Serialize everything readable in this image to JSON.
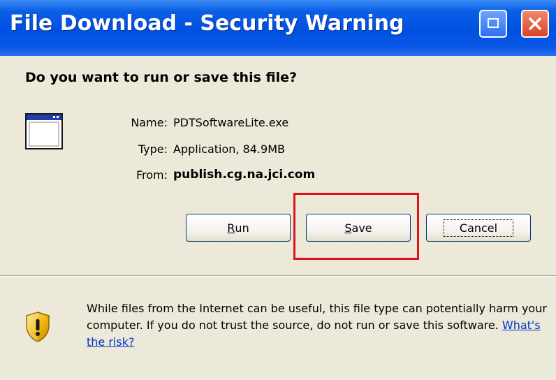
{
  "window": {
    "title": "File Download - Security Warning"
  },
  "dialog": {
    "question": "Do you want to run or save this file?",
    "file": {
      "name_label": "Name:",
      "name_value": "PDTSoftwareLite.exe",
      "type_label": "Type:",
      "type_value": "Application, 84.9MB",
      "from_label": "From:",
      "from_value": "publish.cg.na.jci.com"
    },
    "buttons": {
      "run_mnemonic": "R",
      "run_rest": "un",
      "save_mnemonic": "S",
      "save_rest": "ave",
      "cancel": "Cancel"
    },
    "warning": {
      "text": "While files from the Internet can be useful, this file type can potentially harm your computer. If you do not trust the source, do not run or save this software. ",
      "link": "What's the risk?"
    }
  },
  "colors": {
    "titlebar": "#0050e0",
    "highlight": "#e0131c",
    "link": "#0033cc"
  },
  "icons": [
    "help-icon",
    "close-icon",
    "application-window-icon",
    "security-shield-icon"
  ]
}
